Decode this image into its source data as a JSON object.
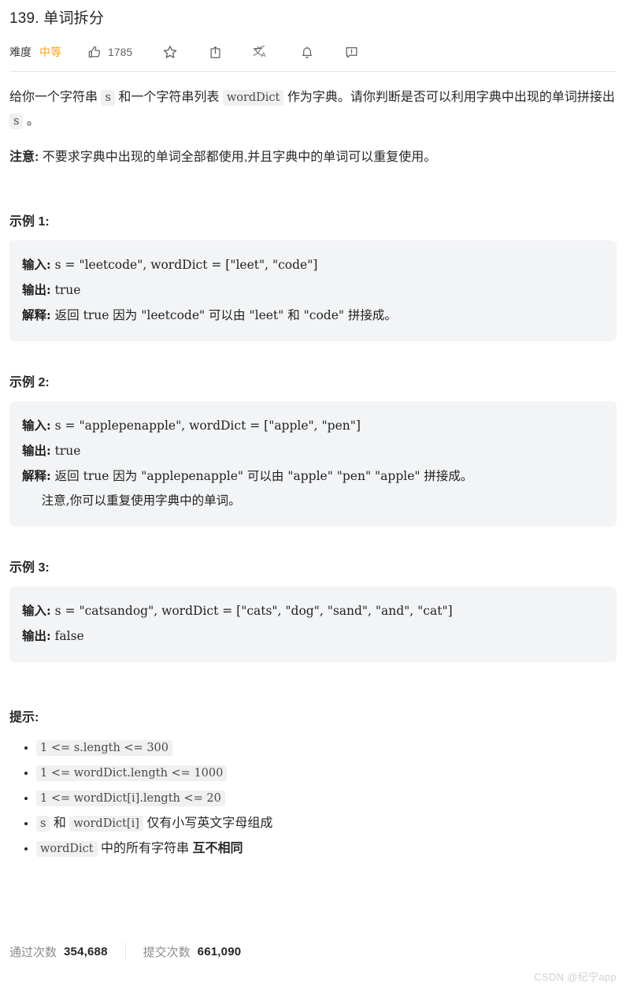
{
  "problem": {
    "title": "139. 单词拆分",
    "difficulty_label": "难度",
    "difficulty_value": "中等",
    "difficulty_color": "#ffa116",
    "vote_count": "1785"
  },
  "toolbar": {
    "icons": [
      {
        "name": "thumbs-up-icon",
        "label": "点赞"
      },
      {
        "name": "star-icon",
        "label": "收藏"
      },
      {
        "name": "share-icon",
        "label": "分享"
      },
      {
        "name": "translate-icon",
        "label": "切换语言"
      },
      {
        "name": "bell-icon",
        "label": "订阅"
      },
      {
        "name": "report-icon",
        "label": "反馈"
      }
    ]
  },
  "description": {
    "para1_a": "给你一个字符串 ",
    "para1_code1": "s",
    "para1_b": " 和一个字符串列表 ",
    "para1_code2": "wordDict",
    "para1_c": " 作为字典。请你判断是否可以利用字典中出现的单词拼接出 ",
    "para1_code3": "s",
    "para1_d": " 。",
    "note_label": "注意:",
    "note_text": " 不要求字典中出现的单词全部都使用,并且字典中的单词可以重复使用。"
  },
  "examples": [
    {
      "heading": "示例 1:",
      "lines": [
        {
          "label": "输入:",
          "text": " s = \"leetcode\", wordDict = [\"leet\", \"code\"]"
        },
        {
          "label": "输出:",
          "text": " true"
        },
        {
          "label": "解释:",
          "text": " 返回 true 因为 \"leetcode\" 可以由 \"leet\" 和 \"code\" 拼接成。"
        }
      ]
    },
    {
      "heading": "示例 2:",
      "lines": [
        {
          "label": "输入:",
          "text": " s = \"applepenapple\", wordDict = [\"apple\", \"pen\"]"
        },
        {
          "label": "输出:",
          "text": " true"
        },
        {
          "label": "解释:",
          "text": " 返回 true 因为 \"applepenapple\" 可以由 \"apple\" \"pen\" \"apple\" 拼接成。\n     注意,你可以重复使用字典中的单词。"
        }
      ]
    },
    {
      "heading": "示例 3:",
      "lines": [
        {
          "label": "输入:",
          "text": " s = \"catsandog\", wordDict = [\"cats\", \"dog\", \"sand\", \"and\", \"cat\"]"
        },
        {
          "label": "输出:",
          "text": " false"
        }
      ]
    }
  ],
  "hints": {
    "heading": "提示:",
    "items": [
      {
        "code": "1 <= s.length <= 300",
        "after": ""
      },
      {
        "code": "1 <= wordDict.length <= 1000",
        "after": ""
      },
      {
        "code": "1 <= wordDict[i].length <= 20",
        "after": ""
      },
      {
        "code": "s",
        "mid": " 和 ",
        "code2": "wordDict[i]",
        "after": " 仅有小写英文字母组成"
      },
      {
        "code": "wordDict",
        "after": " 中的所有字符串 ",
        "bold": "互不相同"
      }
    ]
  },
  "footer": {
    "pass_label": "通过次数",
    "pass_value": "354,688",
    "submit_label": "提交次数",
    "submit_value": "661,090",
    "watermark": "CSDN @纪宁app"
  }
}
